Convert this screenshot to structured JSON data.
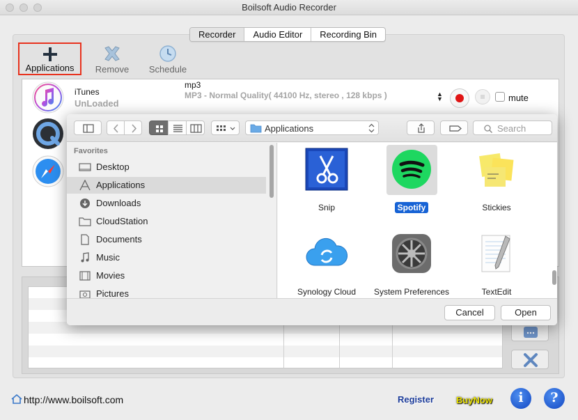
{
  "window": {
    "title": "Boilsoft Audio Recorder"
  },
  "tabs": [
    {
      "label": "Recorder",
      "active": true
    },
    {
      "label": "Audio Editor",
      "active": false
    },
    {
      "label": "Recording Bin",
      "active": false
    }
  ],
  "toolbar": {
    "applications_label": "Applications",
    "remove_label": "Remove",
    "schedule_label": "Schedule",
    "highlight_color": "#e8321e"
  },
  "sources": [
    {
      "name": "iTunes",
      "status": "UnLoaded",
      "format": "mp3",
      "quality": "MP3 - Normal Quality( 44100 Hz, stereo , 128 kbps )",
      "mute_label": "mute",
      "muted": false,
      "icon": "itunes-icon"
    },
    {
      "icon": "quicktime-icon"
    },
    {
      "icon": "safari-icon"
    }
  ],
  "record_color": "#e01414",
  "footer": {
    "url": "http://www.boilsoft.com",
    "register_label": "Register",
    "buynow_label": "BuyNow",
    "info_glyph": "i",
    "help_glyph": "?"
  },
  "dialog": {
    "location": "Applications",
    "search_placeholder": "Search",
    "sidebar_heading": "Favorites",
    "sidebar_items": [
      {
        "label": "Desktop",
        "icon": "desktop-icon",
        "selected": false
      },
      {
        "label": "Applications",
        "icon": "applications-icon",
        "selected": true
      },
      {
        "label": "Downloads",
        "icon": "downloads-icon",
        "selected": false
      },
      {
        "label": "CloudStation",
        "icon": "folder-icon",
        "selected": false
      },
      {
        "label": "Documents",
        "icon": "documents-icon",
        "selected": false
      },
      {
        "label": "Music",
        "icon": "music-icon",
        "selected": false
      },
      {
        "label": "Movies",
        "icon": "movies-icon",
        "selected": false
      },
      {
        "label": "Pictures",
        "icon": "pictures-icon",
        "selected": false
      }
    ],
    "apps": [
      {
        "name": "Snip",
        "icon": "snip-icon",
        "selected": false
      },
      {
        "name": "Spotify",
        "icon": "spotify-icon",
        "selected": true
      },
      {
        "name": "Stickies",
        "icon": "stickies-icon",
        "selected": false
      },
      {
        "name": "Synology Cloud Station",
        "icon": "synology-cloud-icon",
        "selected": false
      },
      {
        "name": "System Preferences",
        "icon": "system-preferences-icon",
        "selected": false
      },
      {
        "name": "TextEdit",
        "icon": "textedit-icon",
        "selected": false
      }
    ],
    "cancel_label": "Cancel",
    "open_label": "Open",
    "selection_color": "#1763d5",
    "spotify_color": "#1ed760"
  }
}
